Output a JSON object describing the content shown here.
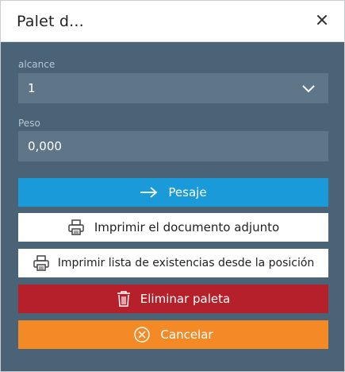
{
  "dialog": {
    "title": "Palet d...",
    "close_icon": "close-icon"
  },
  "form": {
    "range_label": "alcance",
    "range_value": "1",
    "weight_label": "Peso",
    "weight_value": "0,000"
  },
  "buttons": {
    "weigh": "Pesaje",
    "print_attached": "Imprimir el documento adjunto",
    "print_stock": "Imprimir lista de existencias desde la posición",
    "delete": "Eliminar paleta",
    "cancel": "Cancelar"
  },
  "colors": {
    "panel": "#4a6377",
    "field": "#5f7688",
    "blue": "#1a9ad9",
    "red": "#b5202b",
    "orange": "#f48a26"
  }
}
